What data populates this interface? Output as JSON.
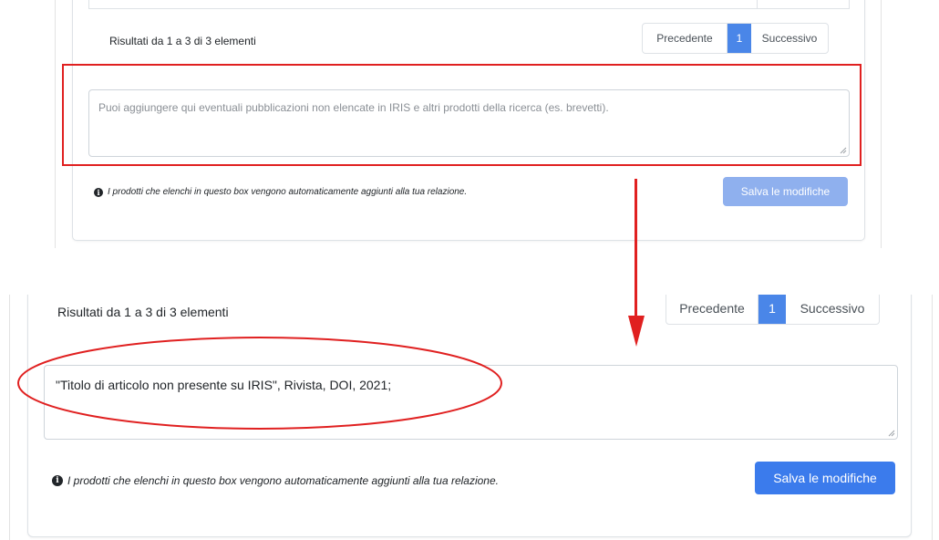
{
  "before": {
    "results_info": "Risultati da 1 a 3 di 3 elementi",
    "pagination": {
      "previous": "Precedente",
      "current_page": "1",
      "next": "Successivo"
    },
    "textarea": {
      "value": "",
      "placeholder": "Puoi aggiungere qui eventuali pubblicazioni non elencate in IRIS e altri prodotti della ricerca (es. brevetti)."
    },
    "note": "I prodotti che elenchi in questo box vengono automaticamente aggiunti alla tua relazione.",
    "save_button": {
      "label": "Salva le modifiche",
      "state": "disabled"
    }
  },
  "after": {
    "results_info": "Risultati da 1 a 3 di 3 elementi",
    "pagination": {
      "previous": "Precedente",
      "current_page": "1",
      "next": "Successivo"
    },
    "textarea": {
      "value": "\"Titolo di articolo non presente su IRIS\", Rivista, DOI, 2021;"
    },
    "note": "I prodotti che elenchi in questo box vengono automaticamente aggiunti alla tua relazione.",
    "save_button": {
      "label": "Salva le modifiche",
      "state": "enabled"
    }
  },
  "icons": {
    "info": "info-circle-icon",
    "resize": "resize-handle-icon"
  },
  "annotation_colors": {
    "highlight": "#e02020",
    "primary_button": "#3b7bec",
    "disabled_button": "#8fb0ee"
  }
}
